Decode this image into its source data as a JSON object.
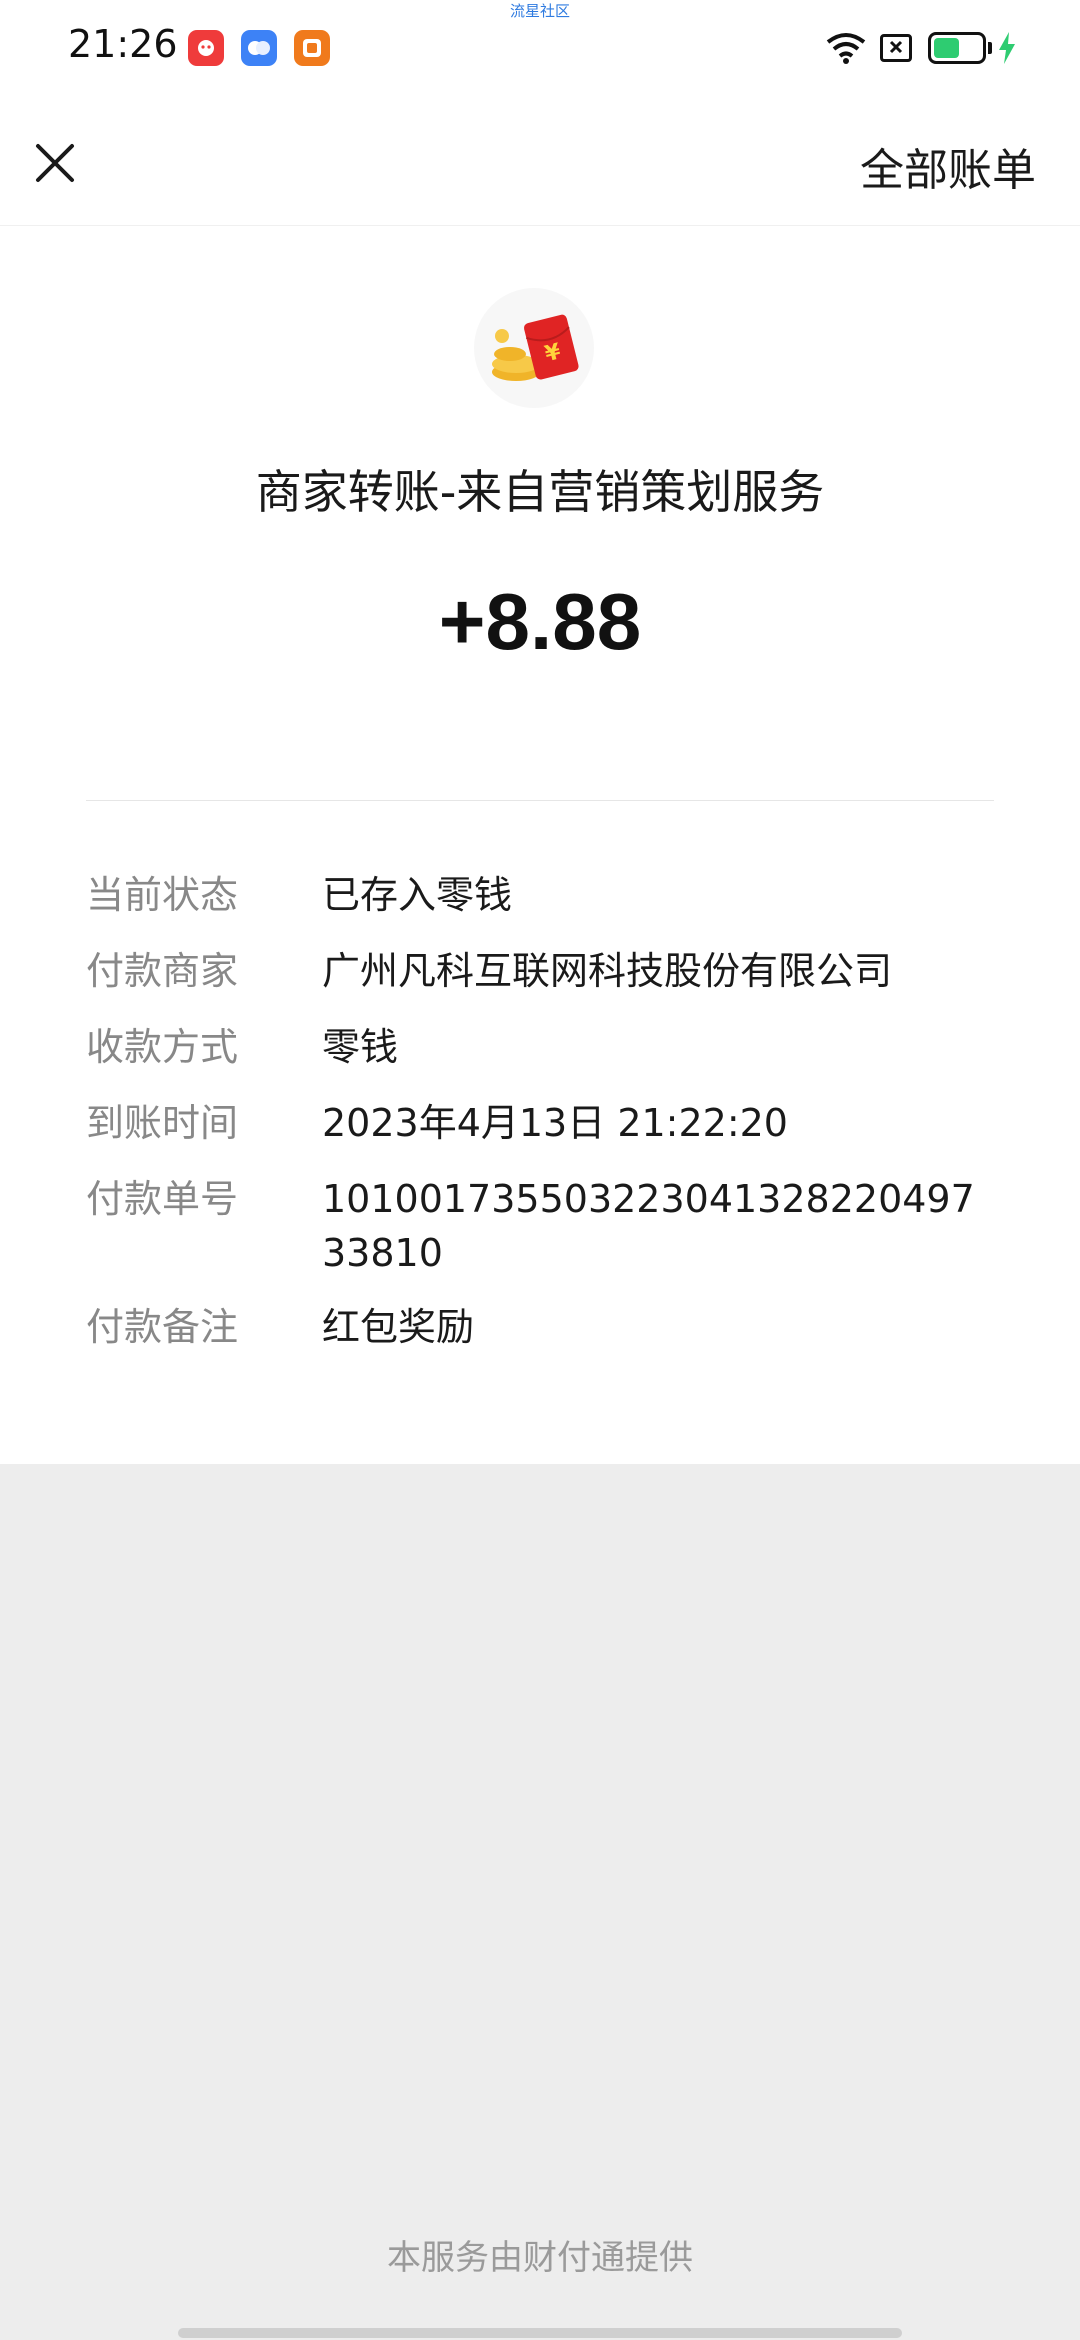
{
  "status_bar": {
    "time": "21:26",
    "watermark": "流星社区",
    "app_icons": [
      "app-notification-icon",
      "app-notification-icon",
      "taobao-icon"
    ],
    "battery_level": 0.55
  },
  "nav": {
    "close_icon": "close-icon",
    "all_bills_label": "全部账单"
  },
  "transaction": {
    "logo_icon": "red-packet-icon",
    "title": "商家转账-来自营销策划服务",
    "amount": "+8.88",
    "details": [
      {
        "label": "当前状态",
        "value": "已存入零钱"
      },
      {
        "label": "付款商家",
        "value": "广州凡科互联网科技股份有限公司"
      },
      {
        "label": "收款方式",
        "value": "零钱"
      },
      {
        "label": "到账时间",
        "value": "2023年4月13日 21:22:20"
      },
      {
        "label": "付款单号",
        "value": "10100173550322304132822049733810"
      },
      {
        "label": "付款备注",
        "value": "红包奖励"
      }
    ]
  },
  "footer": {
    "note": "本服务由财付通提供"
  },
  "colors": {
    "accent_green": "#2ecc71",
    "red_packet": "#e02424",
    "background": "#ededed"
  }
}
